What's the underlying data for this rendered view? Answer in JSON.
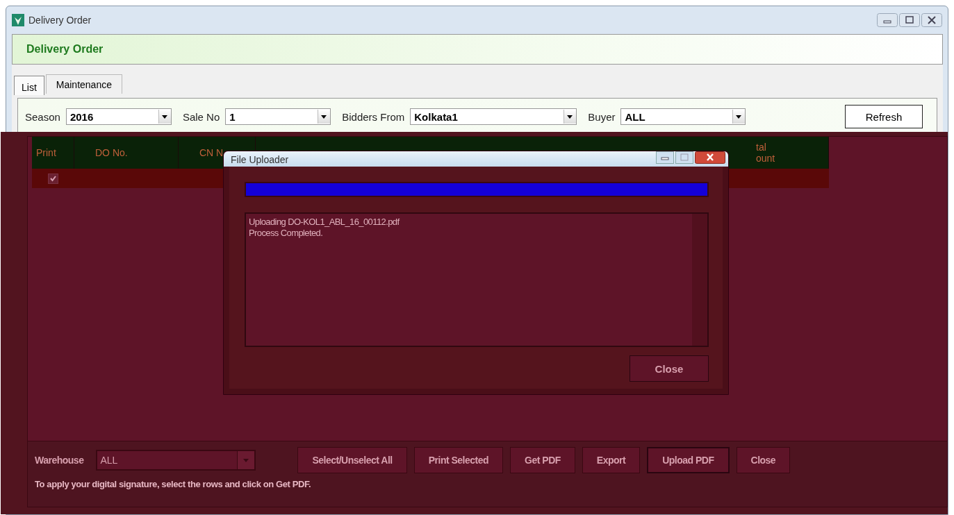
{
  "window": {
    "title": "Delivery Order"
  },
  "header": "Delivery Order",
  "tabs": [
    {
      "label": "List",
      "selected": true
    },
    {
      "label": "Maintenance",
      "selected": false
    }
  ],
  "filters": [
    {
      "label": "Season",
      "value": "2016"
    },
    {
      "label": "Sale No",
      "value": "1"
    },
    {
      "label": "Bidders From",
      "value": "Kolkata1"
    },
    {
      "label": "Buyer",
      "value": "ALL"
    }
  ],
  "refresh_button": "Refresh",
  "table": {
    "columns": [
      {
        "lines": [
          "Print"
        ]
      },
      {
        "lines": [
          "DO No."
        ]
      },
      {
        "lines": [
          "CN N"
        ]
      },
      {
        "lines": [
          "tal",
          "ount"
        ]
      }
    ],
    "rows": [
      {
        "selected": true,
        "checked": true
      }
    ]
  },
  "dialog": {
    "title": "File Uploader",
    "progress": {
      "level": 1
    },
    "log": [
      "Uploading DO-KOL1_ABL_16_00112.pdf",
      "Process Completed."
    ],
    "close_button": "Close"
  },
  "bottom": {
    "warehouse": {
      "label": "Warehouse",
      "value": "ALL"
    },
    "buttons": [
      {
        "label": "Select/Unselect All",
        "default": false
      },
      {
        "label": "Print Selected",
        "default": false
      },
      {
        "label": "Get PDF",
        "default": false
      },
      {
        "label": "Export",
        "default": false
      },
      {
        "label": "Upload PDF",
        "default": true
      },
      {
        "label": "Close",
        "default": false
      }
    ],
    "hint": "To apply your digital signature, select the rows and click on Get PDF."
  }
}
